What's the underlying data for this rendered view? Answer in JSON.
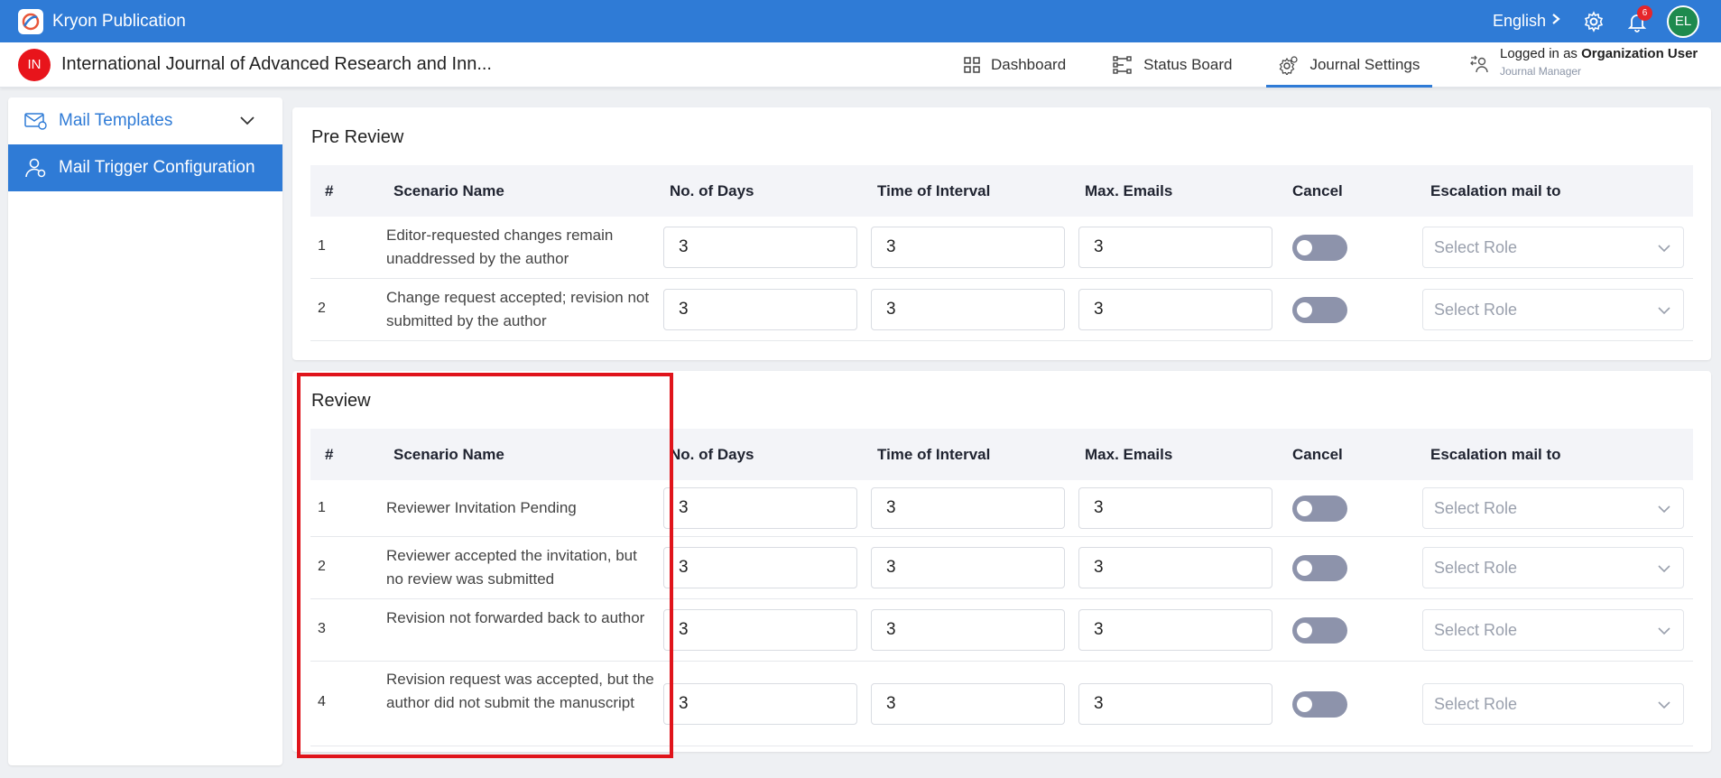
{
  "app": {
    "title": "Kryon Publication",
    "language": "English",
    "notification_count": "6",
    "user_initials": "EL"
  },
  "journal": {
    "initials": "IN",
    "title": "International Journal of Advanced Research and Inn..."
  },
  "nav": {
    "dashboard": "Dashboard",
    "status_board": "Status Board",
    "journal_settings": "Journal Settings"
  },
  "user": {
    "logged_prefix": "Logged in as",
    "name": "Organization User",
    "role": "Journal Manager"
  },
  "sidebar": {
    "mail_templates": "Mail Templates",
    "mail_trigger": "Mail Trigger Configuration"
  },
  "columns": {
    "num": "#",
    "scenario": "Scenario Name",
    "days": "No. of Days",
    "interval": "Time of Interval",
    "max": "Max. Emails",
    "cancel": "Cancel",
    "escalation": "Escalation mail to"
  },
  "select_placeholder": "Select Role",
  "pre_review": {
    "title": "Pre Review",
    "rows": [
      {
        "num": "1",
        "name": "Editor-requested changes remain unaddressed by the author",
        "days": "3",
        "interval": "3",
        "max": "3"
      },
      {
        "num": "2",
        "name": "Change request accepted; revision not submitted by the author",
        "days": "3",
        "interval": "3",
        "max": "3"
      }
    ]
  },
  "review": {
    "title": "Review",
    "rows": [
      {
        "num": "1",
        "name": "Reviewer Invitation Pending",
        "days": "3",
        "interval": "3",
        "max": "3"
      },
      {
        "num": "2",
        "name": "Reviewer accepted the invitation, but no review was submitted",
        "days": "3",
        "interval": "3",
        "max": "3"
      },
      {
        "num": "3",
        "name": "Revision not forwarded back to author",
        "days": "3",
        "interval": "3",
        "max": "3"
      },
      {
        "num": "4",
        "name": "Revision request was accepted, but the author did not submit the manuscript",
        "days": "3",
        "interval": "3",
        "max": "3"
      }
    ]
  },
  "colors": {
    "primary": "#2f7bd6",
    "highlight": "#e0141b",
    "toggle_off": "#8d93ab"
  }
}
